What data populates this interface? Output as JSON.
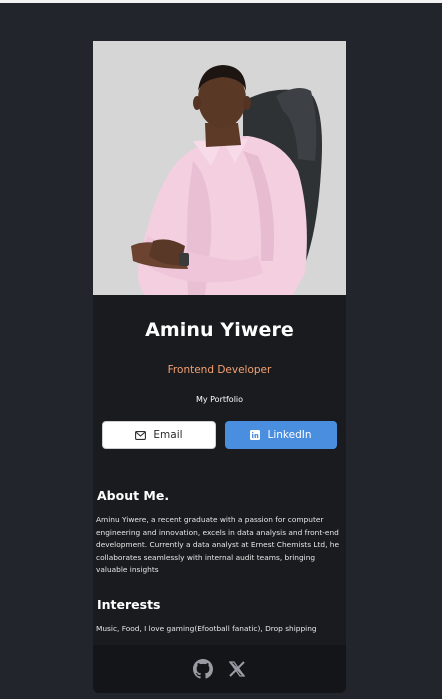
{
  "profile": {
    "name": "Aminu Yiwere",
    "role": "Frontend Developer",
    "portfolio_link": "My Portfolio"
  },
  "buttons": {
    "email_label": "Email",
    "linkedin_label": "LinkedIn"
  },
  "about": {
    "title": "About Me.",
    "text": "Aminu Yiwere, a recent graduate with a passion for computer engineering and innovation, excels in data analysis and front-end development. Currently a data analyst at Ernest Chemists Ltd, he collaborates seamlessly with internal audit teams, bringing valuable insights"
  },
  "interests": {
    "title": "Interests",
    "text": "Music, Food, I love gaming(Efootball fanatic), Drop shipping"
  },
  "footer": {
    "icons": [
      "github-icon",
      "x-twitter-icon"
    ]
  },
  "colors": {
    "page_bg": "#23252c",
    "card_bg": "#1a1b1f",
    "footer_bg": "#141518",
    "accent_orange": "#f3a273",
    "linkedin_blue": "#4a8ee0"
  }
}
